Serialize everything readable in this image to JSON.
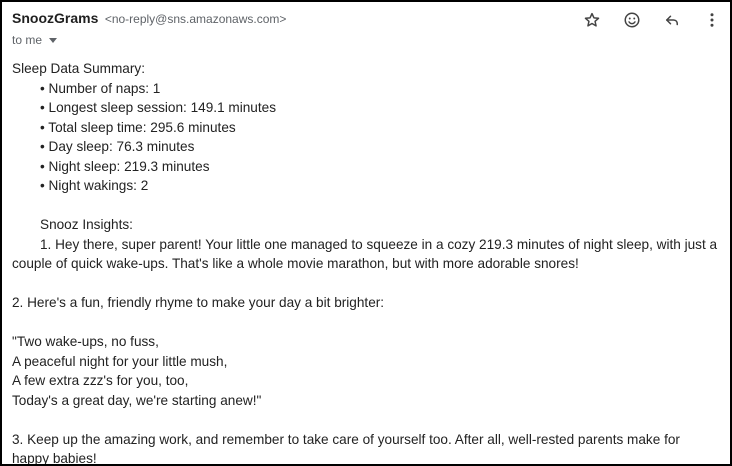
{
  "header": {
    "sender_name": "SnoozGrams",
    "sender_email": "<no-reply@sns.amazonaws.com>",
    "recipient": "to me"
  },
  "body": {
    "summary_title": "Sleep Data Summary:",
    "summary_items": [
      "• Number of naps: 1",
      "• Longest sleep session: 149.1 minutes",
      "• Total sleep time: 295.6 minutes",
      "• Day sleep: 76.3 minutes",
      "• Night sleep: 219.3 minutes",
      "• Night wakings: 2"
    ],
    "insights_title": "Snooz Insights:",
    "insight_1": "1. Hey there, super parent! Your little one managed to squeeze in a cozy 219.3 minutes of night sleep, with just a couple of quick wake-ups. That's like a whole movie marathon, but with more adorable snores!",
    "insight_2": "2. Here's a fun, friendly rhyme to make your day a bit brighter:",
    "rhyme": [
      "\"Two wake-ups, no fuss,",
      "A peaceful night for your little mush,",
      "A few extra zzz's for you, too,",
      "Today's a great day, we're starting anew!\""
    ],
    "insight_3": "3. Keep up the amazing work, and remember to take care of yourself too. After all, well-rested parents make for happy babies!"
  },
  "icons": {
    "star": "star-icon",
    "emoji": "emoji-icon",
    "reply": "reply-icon",
    "more": "more-vert-icon"
  }
}
